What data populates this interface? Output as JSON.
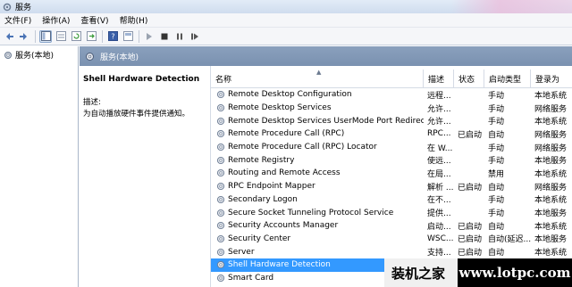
{
  "window": {
    "title": "服务"
  },
  "menu": [
    "文件(F)",
    "操作(A)",
    "查看(V)",
    "帮助(H)"
  ],
  "toolbar": {
    "icons": [
      "back-arrow-icon",
      "forward-arrow-icon",
      "console-tree-icon",
      "properties-icon",
      "refresh-icon",
      "export-icon",
      "help-icon",
      "view-icon",
      "play-icon",
      "stop-icon",
      "pause-icon",
      "restart-icon"
    ]
  },
  "tree": {
    "root_label": "服务(本地)"
  },
  "right_header": {
    "label": "服务(本地)"
  },
  "description_pane": {
    "service_name": "Shell Hardware Detection",
    "desc_label": "描述:",
    "desc_text": "为自动播放硬件事件提供通知。"
  },
  "list": {
    "columns": [
      "名称",
      "描述",
      "状态",
      "启动类型",
      "登录为"
    ],
    "rows": [
      {
        "name": "Remote Desktop Configuration",
        "desc": "远程...",
        "state": "",
        "start": "手动",
        "logon": "本地系统"
      },
      {
        "name": "Remote Desktop Services",
        "desc": "允许...",
        "state": "",
        "start": "手动",
        "logon": "网络服务"
      },
      {
        "name": "Remote Desktop Services UserMode Port Redirector",
        "desc": "允许...",
        "state": "",
        "start": "手动",
        "logon": "本地系统"
      },
      {
        "name": "Remote Procedure Call (RPC)",
        "desc": "RPC...",
        "state": "已启动",
        "start": "自动",
        "logon": "网络服务"
      },
      {
        "name": "Remote Procedure Call (RPC) Locator",
        "desc": "在 W...",
        "state": "",
        "start": "手动",
        "logon": "网络服务"
      },
      {
        "name": "Remote Registry",
        "desc": "使远...",
        "state": "",
        "start": "手动",
        "logon": "本地服务"
      },
      {
        "name": "Routing and Remote Access",
        "desc": "在局...",
        "state": "",
        "start": "禁用",
        "logon": "本地系统"
      },
      {
        "name": "RPC Endpoint Mapper",
        "desc": "解析 ...",
        "state": "已启动",
        "start": "自动",
        "logon": "网络服务"
      },
      {
        "name": "Secondary Logon",
        "desc": "在不...",
        "state": "",
        "start": "手动",
        "logon": "本地系统"
      },
      {
        "name": "Secure Socket Tunneling Protocol Service",
        "desc": "提供...",
        "state": "",
        "start": "手动",
        "logon": "本地服务"
      },
      {
        "name": "Security Accounts Manager",
        "desc": "启动...",
        "state": "已启动",
        "start": "自动",
        "logon": "本地系统"
      },
      {
        "name": "Security Center",
        "desc": "WSC...",
        "state": "已启动",
        "start": "自动(延迟...",
        "logon": "本地服务"
      },
      {
        "name": "Server",
        "desc": "支持...",
        "state": "已启动",
        "start": "自动",
        "logon": "本地系统"
      },
      {
        "name": "Shell Hardware Detection",
        "desc": "",
        "state": "",
        "start": "",
        "logon": "",
        "selected": true
      },
      {
        "name": "Smart Card",
        "desc": "",
        "state": "",
        "start": "",
        "logon": ""
      }
    ]
  },
  "watermark": {
    "left": "装机之家",
    "right": "www.lotpc.com"
  },
  "colors": {
    "selection": "#3399ff",
    "header_bar": "#8aa0bd"
  }
}
